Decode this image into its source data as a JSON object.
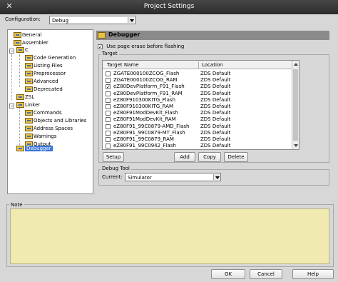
{
  "window": {
    "title": "Project Settings",
    "close_icon": "close-icon"
  },
  "config": {
    "label": "Configuration:",
    "value": "Debug"
  },
  "tree": [
    {
      "label": "General",
      "icon": "settings-page-icon"
    },
    {
      "label": "Assembler",
      "icon": "settings-page-icon"
    },
    {
      "label": "C",
      "icon": "settings-page-icon",
      "expander": "−"
    },
    {
      "label": "Code Generation",
      "icon": "settings-page-icon"
    },
    {
      "label": "Listing Files",
      "icon": "settings-page-icon"
    },
    {
      "label": "Preprocessor",
      "icon": "settings-page-icon"
    },
    {
      "label": "Advanced",
      "icon": "settings-page-icon"
    },
    {
      "label": "Deprecated",
      "icon": "settings-page-icon"
    },
    {
      "label": "ZSL",
      "icon": "settings-page-icon"
    },
    {
      "label": "Linker",
      "icon": "settings-page-icon",
      "expander": "−"
    },
    {
      "label": "Commands",
      "icon": "settings-page-icon"
    },
    {
      "label": "Objects and Libraries",
      "icon": "settings-page-icon"
    },
    {
      "label": "Address Spaces",
      "icon": "settings-page-icon"
    },
    {
      "label": "Warnings",
      "icon": "settings-page-icon"
    },
    {
      "label": "Output",
      "icon": "settings-page-icon"
    },
    {
      "label": "Debugger",
      "icon": "settings-page-icon",
      "selected": true
    }
  ],
  "panel": {
    "title": "Debugger"
  },
  "erase": {
    "label": "Use page erase before flashing",
    "checked": true,
    "mark": "✓"
  },
  "target": {
    "group_label": "Target",
    "col_name": "Target Name",
    "col_location": "Location",
    "rows": [
      {
        "name": "ZGATE000100ZCOG_Flash",
        "location": "ZDS Default",
        "checked": false
      },
      {
        "name": "ZGATE000100ZCOG_RAM",
        "location": "ZDS Default",
        "checked": false
      },
      {
        "name": "eZ80DevPlatform_F91_Flash",
        "location": "ZDS Default",
        "checked": true
      },
      {
        "name": "eZ80DevPlatform_F91_RAM",
        "location": "ZDS Default",
        "checked": false
      },
      {
        "name": "eZ80F910300KITG_Flash",
        "location": "ZDS Default",
        "checked": false
      },
      {
        "name": "eZ80F910300KITG_RAM",
        "location": "ZDS Default",
        "checked": false
      },
      {
        "name": "eZ80F91ModDevKit_Flash",
        "location": "ZDS Default",
        "checked": false
      },
      {
        "name": "eZ80F91ModDevKit_RAM",
        "location": "ZDS Default",
        "checked": false
      },
      {
        "name": "eZ80F91_99C0879-AMD_Flash",
        "location": "ZDS Default",
        "checked": false
      },
      {
        "name": "eZ80F91_99C0879-MT_Flash",
        "location": "ZDS Default",
        "checked": false
      },
      {
        "name": "eZ80F91_99C0879_RAM",
        "location": "ZDS Default",
        "checked": false
      },
      {
        "name": "eZ80F91_99C0942_Flash",
        "location": "ZDS Default",
        "checked": false
      }
    ],
    "buttons": {
      "setup": "Setup",
      "add": "Add",
      "copy": "Copy",
      "delete": "Delete"
    }
  },
  "debug_tool": {
    "group_label": "Debug Tool",
    "current_label": "Current:",
    "current_value": "Simulator"
  },
  "note": {
    "label": "Note",
    "text": ""
  },
  "footer": {
    "ok": "OK",
    "cancel": "Cancel",
    "help": "Help"
  },
  "colors": {
    "selection": "#3874d8",
    "note_bg": "#f0eab0",
    "header_bg": "#8a8a8a"
  }
}
